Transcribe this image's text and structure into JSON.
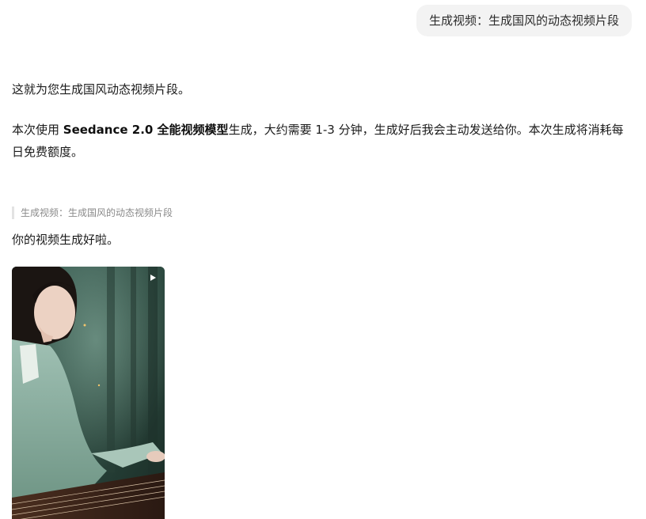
{
  "user_message": "生成视频：生成国风的动态视频片段",
  "assistant": {
    "reply_1": "这就为您生成国风动态视频片段。",
    "reply_2_prefix": "本次使用 ",
    "reply_2_model": "Seedance 2.0 全能视频模型",
    "reply_2_suffix": "生成，大约需要 1-3 分钟，生成好后我会主动发送给你。本次生成将消耗每日免费额度。",
    "quote_text": "生成视频：生成国风的动态视频片段",
    "reply_3": "你的视频生成好啦。"
  },
  "video": {
    "play_icon": "play-icon",
    "thumbnail_subject": "woman-in-hanfu-playing-guzheng"
  }
}
